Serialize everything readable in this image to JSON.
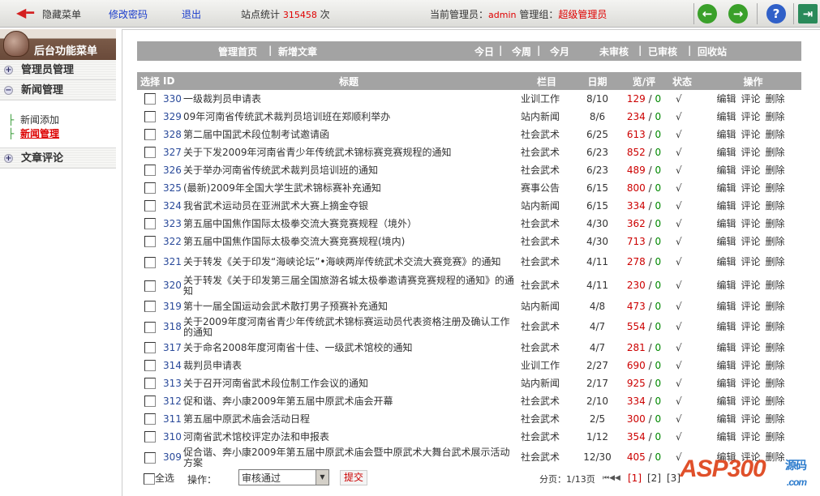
{
  "topbar": {
    "hide_menu": "隐藏菜单",
    "change_password": "修改密码",
    "logout": "退出",
    "stats_label": "站点统计",
    "stats_value": "315458",
    "stats_unit": "次",
    "admin_label": "当前管理员：",
    "admin_name": "admin",
    "group_label": "管理组：",
    "group_name": "超级管理员"
  },
  "sidebar": {
    "title": "后台功能菜单",
    "sections": [
      {
        "label": "管理员管理",
        "sign": "+"
      },
      {
        "label": "新闻管理",
        "sign": "−"
      },
      {
        "label": "文章评论",
        "sign": "+"
      }
    ],
    "sub_items": [
      {
        "label": "新闻添加"
      },
      {
        "label": "新闻管理"
      }
    ]
  },
  "toolbar": {
    "home": "管理首页",
    "sep": "|",
    "add": "新增文章",
    "today": "今日",
    "week": "今周",
    "month": "今月",
    "unreviewed": "未审核",
    "reviewed": "已审核",
    "recycle": "回收站"
  },
  "table": {
    "headers": [
      "选择",
      "ID",
      "标题",
      "栏目",
      "日期",
      "览/评",
      "状态",
      "操作"
    ],
    "ops": [
      "编辑",
      "评论",
      "删除"
    ],
    "rows": [
      {
        "id": "330",
        "title": "一级裁判员申请表",
        "cat": "业训工作",
        "date": "8/10",
        "views": "129",
        "comments": "0",
        "status": "√"
      },
      {
        "id": "329",
        "title": "09年河南省传统武术裁判员培训班在郑顺利举办",
        "cat": "站内新闻",
        "date": "8/6",
        "views": "234",
        "comments": "0",
        "status": "√"
      },
      {
        "id": "328",
        "title": "第二届中国武术段位制考试邀请函",
        "cat": "社会武术",
        "date": "6/25",
        "views": "613",
        "comments": "0",
        "status": "√"
      },
      {
        "id": "327",
        "title": "关于下发2009年河南省青少年传统武术锦标赛竞赛规程的通知",
        "cat": "社会武术",
        "date": "6/23",
        "views": "852",
        "comments": "0",
        "status": "√"
      },
      {
        "id": "326",
        "title": "关于举办河南省传统武术裁判员培训班的通知",
        "cat": "社会武术",
        "date": "6/23",
        "views": "489",
        "comments": "0",
        "status": "√"
      },
      {
        "id": "325",
        "title": "(最新)2009年全国大学生武术锦标赛补充通知",
        "cat": "赛事公告",
        "date": "6/15",
        "views": "800",
        "comments": "0",
        "status": "√"
      },
      {
        "id": "324",
        "title": "我省武术运动员在亚洲武术大赛上摘金夺银",
        "cat": "站内新闻",
        "date": "6/15",
        "views": "334",
        "comments": "0",
        "status": "√"
      },
      {
        "id": "323",
        "title": "第五届中国焦作国际太极拳交流大赛竞赛规程（境外）",
        "cat": "社会武术",
        "date": "4/30",
        "views": "362",
        "comments": "0",
        "status": "√"
      },
      {
        "id": "322",
        "title": "第五届中国焦作国际太极拳交流大赛竞赛规程(境内)",
        "cat": "社会武术",
        "date": "4/30",
        "views": "713",
        "comments": "0",
        "status": "√"
      },
      {
        "id": "321",
        "title": "关于转发《关于印发“海峡论坛”•海峡两岸传统武术交流大赛竞赛》的通知",
        "cat": "社会武术",
        "date": "4/11",
        "views": "278",
        "comments": "0",
        "status": "√",
        "dbl": true
      },
      {
        "id": "320",
        "title": "关于转发《关于印发第三届全国旅游名城太极拳邀请赛竞赛规程的通知》的通知",
        "cat": "社会武术",
        "date": "4/11",
        "views": "230",
        "comments": "0",
        "status": "√",
        "dbl": true
      },
      {
        "id": "319",
        "title": "第十一届全国运动会武术散打男子预赛补充通知",
        "cat": "站内新闻",
        "date": "4/8",
        "views": "473",
        "comments": "0",
        "status": "√"
      },
      {
        "id": "318",
        "title": "关于2009年度河南省青少年传统武术锦标赛运动员代表资格注册及确认工作的通知",
        "cat": "社会武术",
        "date": "4/7",
        "views": "554",
        "comments": "0",
        "status": "√",
        "dbl": true
      },
      {
        "id": "317",
        "title": "关于命名2008年度河南省十佳、一级武术馆校的通知",
        "cat": "社会武术",
        "date": "4/7",
        "views": "281",
        "comments": "0",
        "status": "√"
      },
      {
        "id": "314",
        "title": "裁判员申请表",
        "cat": "业训工作",
        "date": "2/27",
        "views": "690",
        "comments": "0",
        "status": "√"
      },
      {
        "id": "313",
        "title": "关于召开河南省武术段位制工作会议的通知",
        "cat": "站内新闻",
        "date": "2/17",
        "views": "925",
        "comments": "0",
        "status": "√"
      },
      {
        "id": "312",
        "title": "促和谐、奔小康2009年第五届中原武术庙会开幕",
        "cat": "社会武术",
        "date": "2/10",
        "views": "334",
        "comments": "0",
        "status": "√"
      },
      {
        "id": "311",
        "title": "第五届中原武术庙会活动日程",
        "cat": "社会武术",
        "date": "2/5",
        "views": "300",
        "comments": "0",
        "status": "√"
      },
      {
        "id": "310",
        "title": "河南省武术馆校评定办法和申报表",
        "cat": "社会武术",
        "date": "1/12",
        "views": "354",
        "comments": "0",
        "status": "√"
      },
      {
        "id": "309",
        "title": "促合谐、奔小康2009年第五届中原武术庙会暨中原武术大舞台武术展示活动方案",
        "cat": "社会武术",
        "date": "12/30",
        "views": "405",
        "comments": "0",
        "status": "√",
        "dbl": true
      }
    ]
  },
  "bottom": {
    "select_all": "全选",
    "operation_label": "操作：",
    "operation_value": "审核通过",
    "submit": "提交",
    "paging": "分页：1/13页",
    "first_prev": "⏮◀◀",
    "pages": [
      "[1]",
      "[2]",
      "[3]"
    ]
  },
  "watermark": {
    "text": "ASP300",
    "cn": "源码",
    "com": ".com"
  },
  "colors": {
    "bar": "#a3a3a3",
    "accent_red": "#e00000",
    "link_blue": "#1a3ccc"
  }
}
